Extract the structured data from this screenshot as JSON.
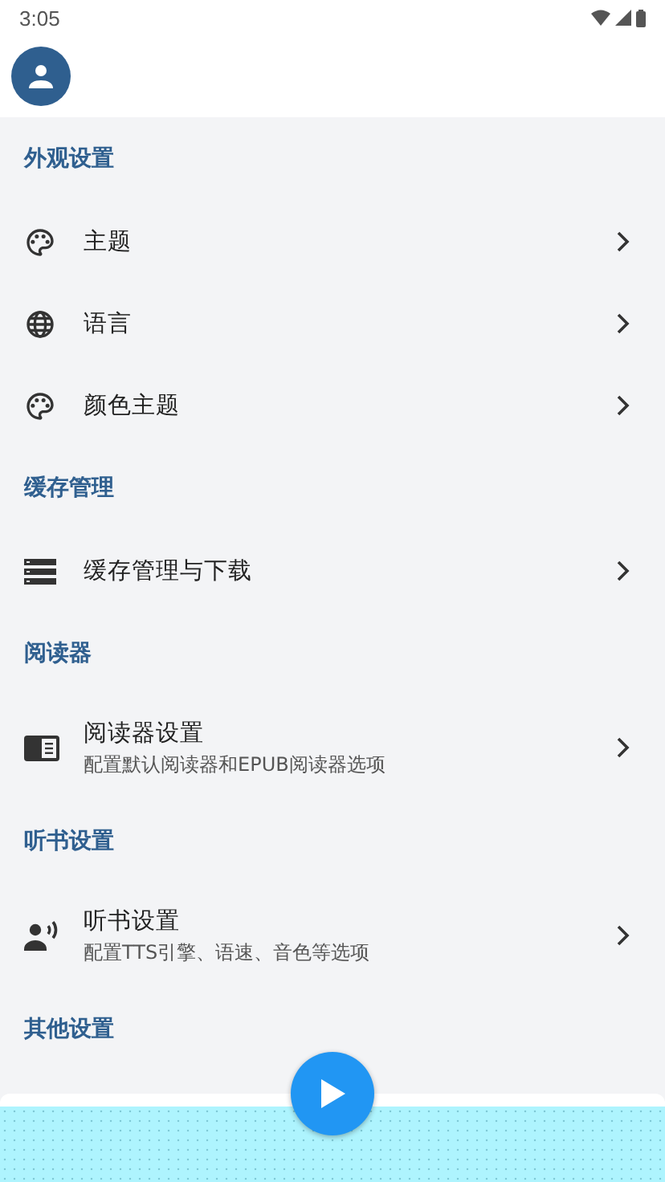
{
  "status_bar": {
    "time": "3:05"
  },
  "sections": [
    {
      "title": "外观设置",
      "items": [
        {
          "title": "主题"
        },
        {
          "title": "语言"
        },
        {
          "title": "颜色主题"
        }
      ]
    },
    {
      "title": "缓存管理",
      "items": [
        {
          "title": "缓存管理与下载"
        }
      ]
    },
    {
      "title": "阅读器",
      "items": [
        {
          "title": "阅读器设置",
          "subtitle": "配置默认阅读器和EPUB阅读器选项"
        }
      ]
    },
    {
      "title": "听书设置",
      "items": [
        {
          "title": "听书设置",
          "subtitle": "配置TTS引擎、语速、音色等选项"
        }
      ]
    },
    {
      "title": "其他设置"
    }
  ]
}
